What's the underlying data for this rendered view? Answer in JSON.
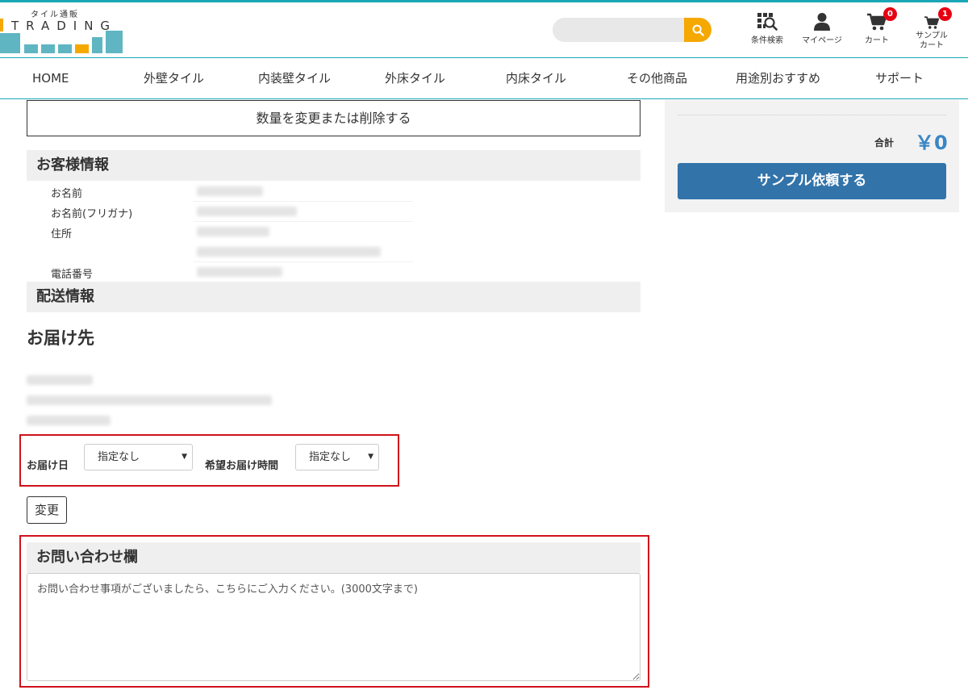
{
  "header": {
    "logo_sub": "タイル通販",
    "logo_name": "TRADING",
    "search_placeholder": "",
    "icons": [
      {
        "name": "condition-search-icon",
        "label": "条件検索"
      },
      {
        "name": "user-icon",
        "label": "マイページ"
      },
      {
        "name": "cart-icon",
        "label": "カート",
        "badge": "0"
      },
      {
        "name": "sample-cart-icon",
        "label_line1": "サンプル",
        "label_line2": "カート",
        "badge": "1"
      }
    ]
  },
  "nav": [
    "HOME",
    "外壁タイル",
    "内装壁タイル",
    "外床タイル",
    "内床タイル",
    "その他商品",
    "用途別おすすめ",
    "サポート"
  ],
  "main": {
    "change_qty_label": "数量を変更または削除する",
    "customer_section": "お客様情報",
    "customer_labels": {
      "name": "お名前",
      "kana": "お名前(フリガナ)",
      "address": "住所",
      "phone": "電話番号"
    },
    "shipping_section": "配送情報",
    "destination_title": "お届け先",
    "delivery_date_label": "お届け日",
    "delivery_date_value": "指定なし",
    "delivery_time_label": "希望お届け時間",
    "delivery_time_value": "指定なし",
    "change_button": "変更",
    "inquiry_section": "お問い合わせ欄",
    "inquiry_placeholder": "お問い合わせ事項がございましたら、こちらにご入力ください。(3000文字まで)"
  },
  "summary": {
    "total_label": "合計",
    "total_value": "￥0",
    "request_button": "サンプル依頼する"
  },
  "colors": {
    "accent": "#1aa7b5",
    "search_button": "#f5a800",
    "badge": "#e60012",
    "primary_button": "#3273aa",
    "total_text": "#3a86c4",
    "highlight_box": "#d0121b"
  }
}
